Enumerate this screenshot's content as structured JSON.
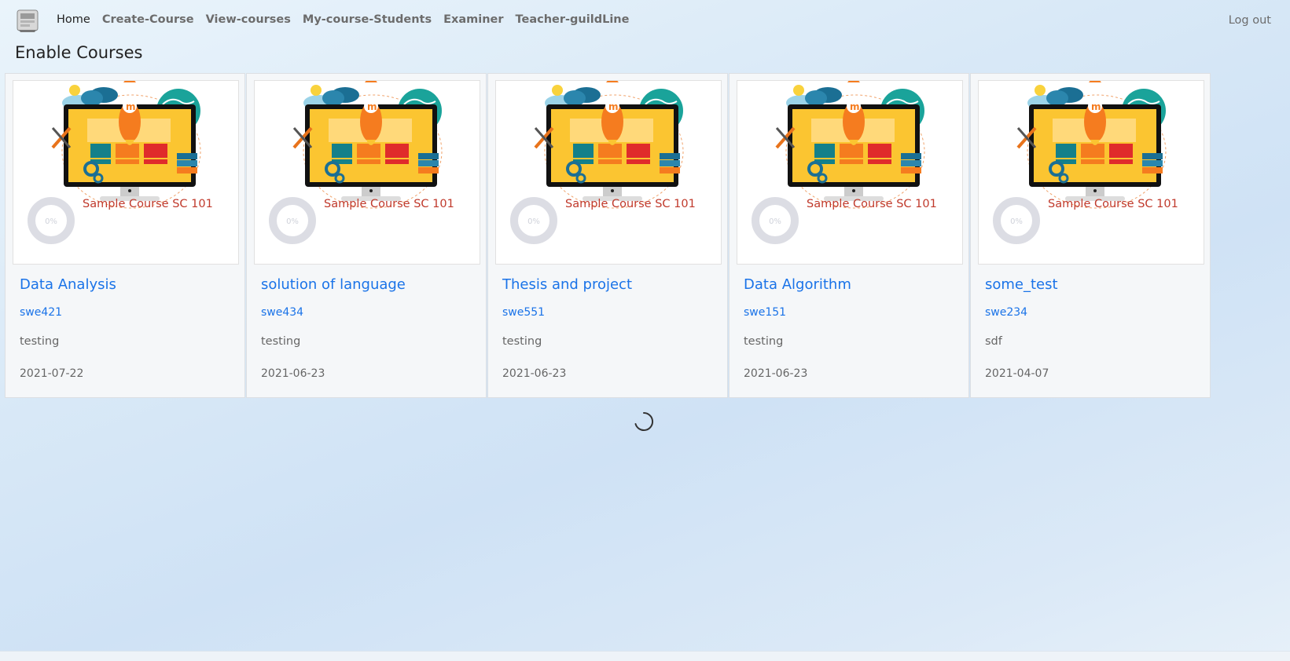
{
  "nav": {
    "links": [
      "Home",
      "Create-Course",
      "View-courses",
      "My-course-Students",
      "Examiner",
      "Teacher-guildLine"
    ],
    "logout": "Log out"
  },
  "page_title": "Enable Courses",
  "courses": [
    {
      "name": "Data Analysis",
      "code": "swe421",
      "description": "testing",
      "date": "2021-07-22",
      "image_caption": "Sample Course SC 101",
      "progress": "0%"
    },
    {
      "name": "solution of language",
      "code": "swe434",
      "description": "testing",
      "date": "2021-06-23",
      "image_caption": "Sample Course SC 101",
      "progress": "0%"
    },
    {
      "name": "Thesis and project",
      "code": "swe551",
      "description": "testing",
      "date": "2021-06-23",
      "image_caption": "Sample Course SC 101",
      "progress": "0%"
    },
    {
      "name": "Data Algorithm",
      "code": "swe151",
      "description": "testing",
      "date": "2021-06-23",
      "image_caption": "Sample Course SC 101",
      "progress": "0%"
    },
    {
      "name": "some_test",
      "code": "swe234",
      "description": "sdf",
      "date": "2021-04-07",
      "image_caption": "Sample Course SC 101",
      "progress": "0%"
    }
  ],
  "colors": {
    "link": "#1a73e8",
    "caption": "#c0392b"
  }
}
